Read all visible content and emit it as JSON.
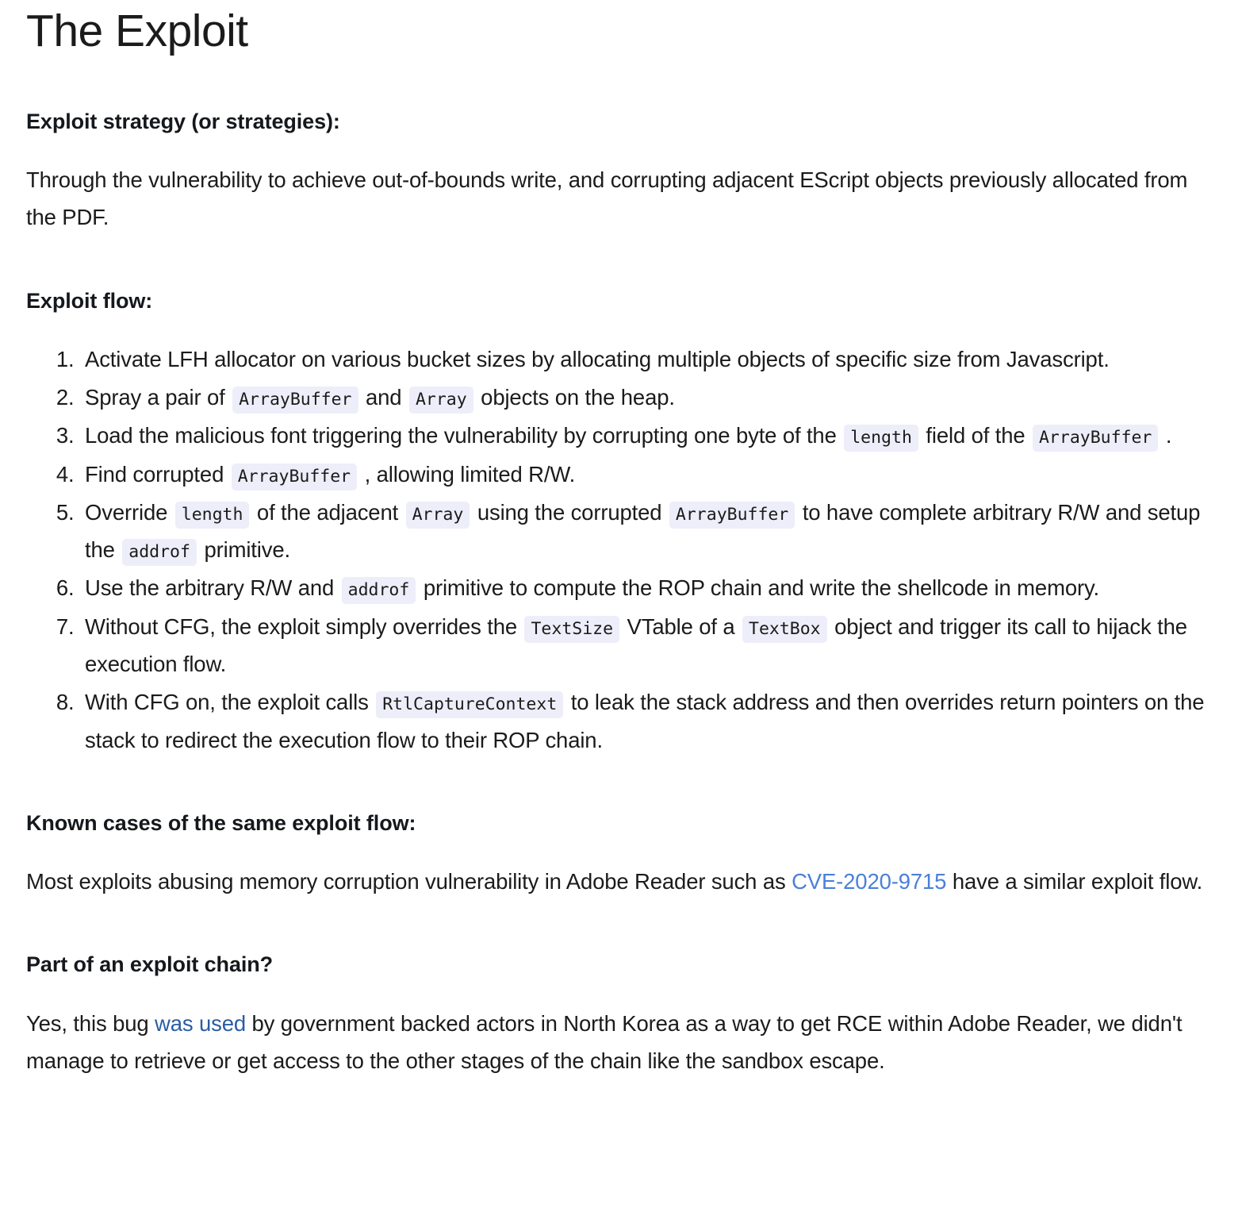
{
  "title": "The Exploit",
  "sections": {
    "strategy_heading": "Exploit strategy (or strategies):",
    "strategy_body": "Through the vulnerability to achieve out-of-bounds write, and corrupting adjacent EScript objects previously allocated from the PDF.",
    "flow_heading": "Exploit flow:",
    "known_cases_heading": "Known cases of the same exploit flow:",
    "chain_heading": "Part of an exploit chain?"
  },
  "flow_items": {
    "item1": {
      "t1": "Activate LFH allocator on various bucket sizes by allocating multiple objects of specific size from Javascript."
    },
    "item2": {
      "t1": "Spray a pair of",
      "c1": "ArrayBuffer",
      "t2": "and",
      "c2": "Array",
      "t3": "objects on the heap."
    },
    "item3": {
      "t1": "Load the malicious font triggering the vulnerability by corrupting one byte of the",
      "c1": "length",
      "t2": "field of the",
      "c2": "ArrayBuffer",
      "t3": "."
    },
    "item4": {
      "t1": "Find corrupted",
      "c1": "ArrayBuffer",
      "t2": ", allowing limited R/W."
    },
    "item5": {
      "t1": "Override",
      "c1": "length",
      "t2": "of the adjacent",
      "c2": "Array",
      "t3": "using the corrupted",
      "c3": "ArrayBuffer",
      "t4": "to have complete arbitrary R/W and setup the",
      "c4": "addrof",
      "t5": "primitive."
    },
    "item6": {
      "t1": "Use the arbitrary R/W and",
      "c1": "addrof",
      "t2": "primitive to compute the ROP chain and write the shellcode in memory."
    },
    "item7": {
      "t1": "Without CFG, the exploit simply overrides the",
      "c1": "TextSize",
      "t2": "VTable of a",
      "c2": "TextBox",
      "t3": "object and trigger its call to hijack the execution flow."
    },
    "item8": {
      "t1": "With CFG on, the exploit calls",
      "c1": "RtlCaptureContext",
      "t2": "to leak the stack address and then overrides return pointers on the stack to redirect the execution flow to their ROP chain."
    }
  },
  "known_cases_paragraph": {
    "t1": "Most exploits abusing memory corruption vulnerability in Adobe Reader such as",
    "link": "CVE-2020-9715",
    "t2": "have a similar exploit flow."
  },
  "chain_paragraph": {
    "t1": "Yes, this bug",
    "link": "was used",
    "t2": "by government backed actors in North Korea as a way to get RCE within Adobe Reader, we didn't manage to retrieve or get access to the other stages of the chain like the sandbox escape."
  },
  "colors": {
    "text": "#1b1b1b",
    "chip_background": "#edeef9",
    "link_bright": "#4a80d8",
    "link_muted": "#2a5da4",
    "page_background": "#ffffff"
  }
}
